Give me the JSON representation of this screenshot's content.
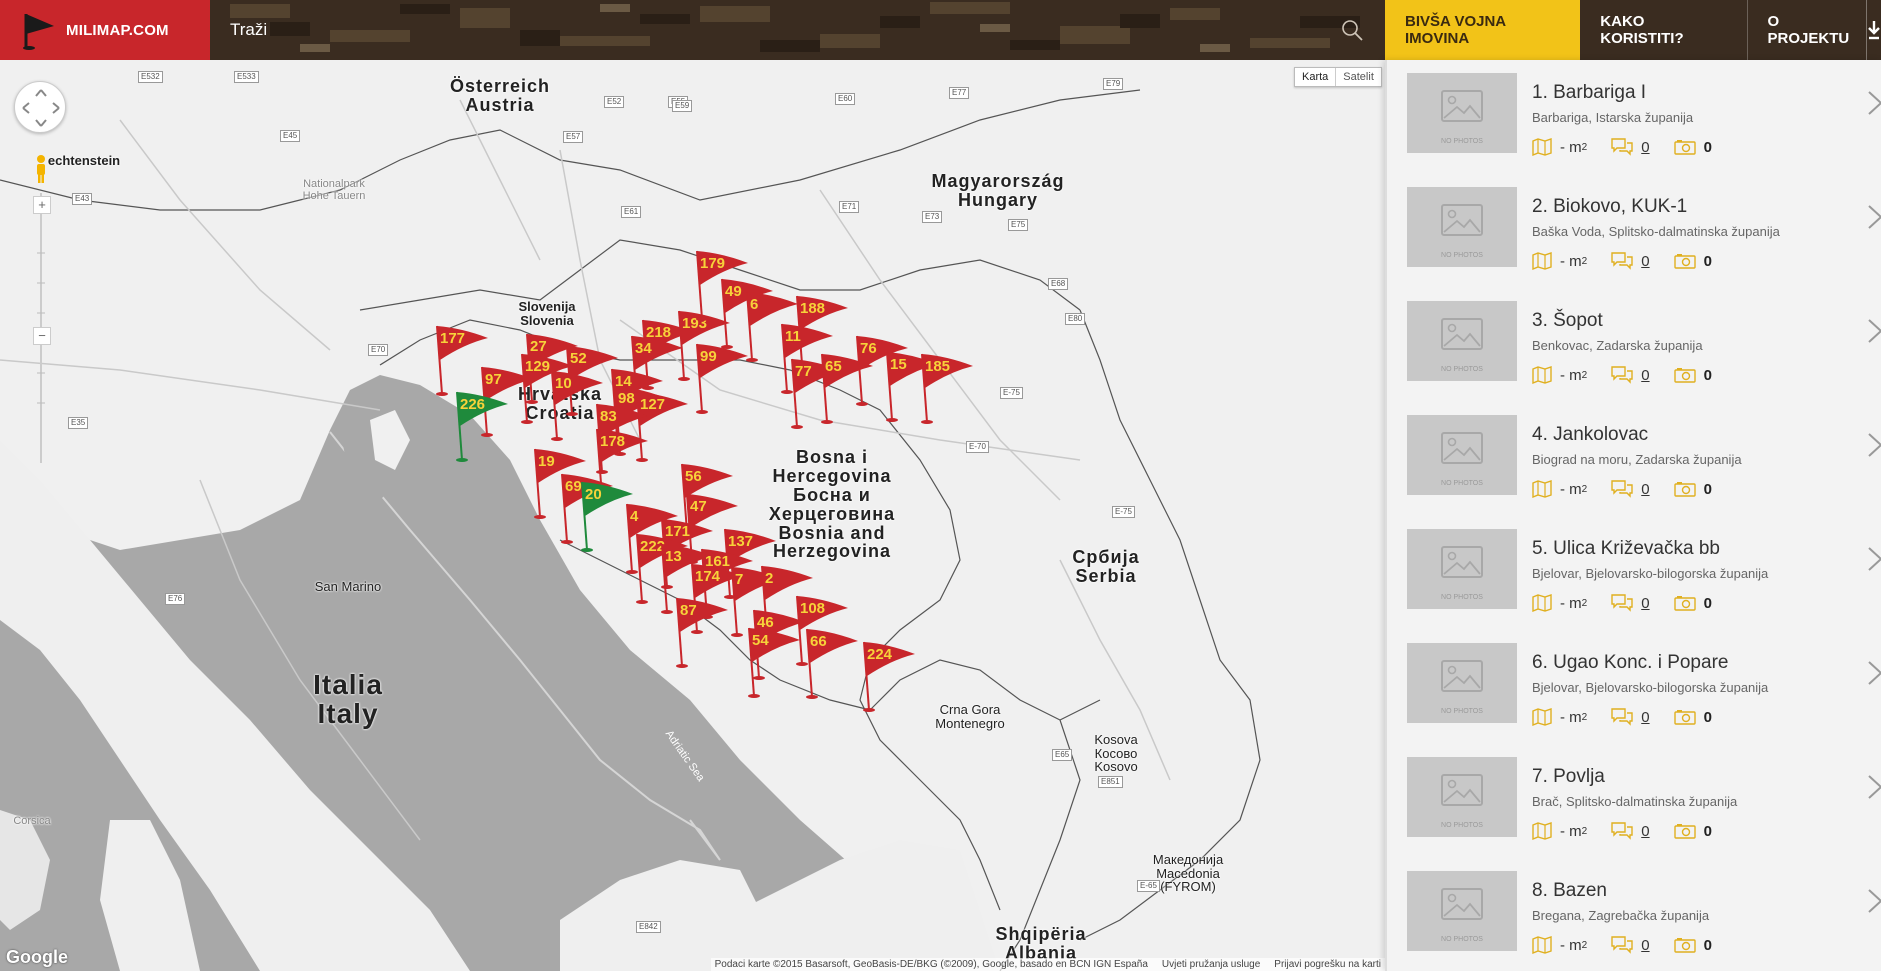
{
  "header": {
    "logo_text": "MILIMAP.COM",
    "search_placeholder": "Traži",
    "nav": [
      "BIVŠA VOJNA IMOVINA",
      "KAKO KORISTITI?",
      "O PROJEKTU"
    ],
    "brand_color": "#c8262b",
    "active_tab_color": "#f2c318"
  },
  "map": {
    "map_type": {
      "map": "Karta",
      "satellite": "Satelit"
    },
    "google_logo": "Google",
    "attribution": [
      "Podaci karte ©2015 Basarsoft, GeoBasis-DE/BKG (©2009), Google, basado en BCN IGN España",
      "Uvjeti pružanja usluge",
      "Prijavi pogrešku na karti"
    ],
    "labels": {
      "austria": "Österreich\nAustria",
      "hungary": "Magyarország\nHungary",
      "slovenia": "Slovenija\nSlovenia",
      "croatia": "Hrvatska\nCroatia",
      "bosnia": "Bosna i\nHercegovina\nБосна и\nХерцеговина\nBosnia and\nHerzegovina",
      "serbia": "Србија\nSerbia",
      "italy": "Italia\nItaly",
      "san_marino": "San Marino",
      "montenegro": "Crna Gora\nMontenegro",
      "kosovo": "Kosova\nКосово\nKosovo",
      "macedonia": "Македонија\nMacedonia\n(FYROM)",
      "albania": "Shqipëria\nAlbania",
      "liechtenstein": "echtenstein",
      "nationalpark": "Nationalpark\nHohe Tauern",
      "corsica": "Corsica",
      "adriatic": "Adriatic Sea"
    },
    "roads": [
      "E532",
      "E533",
      "E45",
      "E60",
      "E52",
      "E55",
      "E59",
      "E57",
      "E77",
      "E71",
      "E79",
      "E43",
      "E61",
      "E75",
      "E73",
      "E68",
      "E70",
      "E65",
      "E35",
      "E76",
      "E851",
      "E842",
      "E80",
      "E-75",
      "E-70",
      "E-65",
      "E-75"
    ],
    "markers": [
      {
        "n": "177",
        "c": "red"
      },
      {
        "n": "97",
        "c": "red"
      },
      {
        "n": "27",
        "c": "red"
      },
      {
        "n": "129",
        "c": "red"
      },
      {
        "n": "52",
        "c": "red"
      },
      {
        "n": "10",
        "c": "red"
      },
      {
        "n": "218",
        "c": "red"
      },
      {
        "n": "193",
        "c": "red"
      },
      {
        "n": "34",
        "c": "red"
      },
      {
        "n": "179",
        "c": "red"
      },
      {
        "n": "49",
        "c": "red"
      },
      {
        "n": "6",
        "c": "red"
      },
      {
        "n": "188",
        "c": "red"
      },
      {
        "n": "11",
        "c": "red"
      },
      {
        "n": "99",
        "c": "red"
      },
      {
        "n": "14",
        "c": "red"
      },
      {
        "n": "98",
        "c": "red"
      },
      {
        "n": "127",
        "c": "red"
      },
      {
        "n": "83",
        "c": "red"
      },
      {
        "n": "77",
        "c": "red"
      },
      {
        "n": "65",
        "c": "red"
      },
      {
        "n": "76",
        "c": "red"
      },
      {
        "n": "15",
        "c": "red"
      },
      {
        "n": "185",
        "c": "red"
      },
      {
        "n": "226",
        "c": "green"
      },
      {
        "n": "178",
        "c": "red"
      },
      {
        "n": "19",
        "c": "red"
      },
      {
        "n": "69",
        "c": "red"
      },
      {
        "n": "20",
        "c": "green"
      },
      {
        "n": "56",
        "c": "red"
      },
      {
        "n": "47",
        "c": "red"
      },
      {
        "n": "4",
        "c": "red"
      },
      {
        "n": "171",
        "c": "red"
      },
      {
        "n": "222",
        "c": "red"
      },
      {
        "n": "137",
        "c": "red"
      },
      {
        "n": "13",
        "c": "red"
      },
      {
        "n": "161",
        "c": "red"
      },
      {
        "n": "174",
        "c": "red"
      },
      {
        "n": "7",
        "c": "red"
      },
      {
        "n": "2",
        "c": "red"
      },
      {
        "n": "87",
        "c": "red"
      },
      {
        "n": "108",
        "c": "red"
      },
      {
        "n": "46",
        "c": "red"
      },
      {
        "n": "54",
        "c": "red"
      },
      {
        "n": "66",
        "c": "red"
      },
      {
        "n": "224",
        "c": "red"
      }
    ]
  },
  "list": [
    {
      "title": "1. Barbariga I",
      "location": "Barbariga, Istarska županija",
      "area": "- m",
      "comments": "0",
      "photos": "0",
      "no_photos": "NO PHOTOS"
    },
    {
      "title": "2. Biokovo, KUK-1",
      "location": "Baška Voda, Splitsko-dalmatinska županija",
      "area": "- m",
      "comments": "0",
      "photos": "0",
      "no_photos": "NO PHOTOS"
    },
    {
      "title": "3. Šopot",
      "location": "Benkovac, Zadarska županija",
      "area": "- m",
      "comments": "0",
      "photos": "0",
      "no_photos": "NO PHOTOS"
    },
    {
      "title": "4. Jankolovac",
      "location": "Biograd na moru, Zadarska županija",
      "area": "- m",
      "comments": "0",
      "photos": "0",
      "no_photos": "NO PHOTOS"
    },
    {
      "title": "5. Ulica Križevačka bb",
      "location": "Bjelovar, Bjelovarsko-bilogorska županija",
      "area": "- m",
      "comments": "0",
      "photos": "0",
      "no_photos": "NO PHOTOS"
    },
    {
      "title": "6. Ugao Konc. i Popare",
      "location": "Bjelovar, Bjelovarsko-bilogorska županija",
      "area": "- m",
      "comments": "0",
      "photos": "0",
      "no_photos": "NO PHOTOS"
    },
    {
      "title": "7. Povlja",
      "location": "Brač, Splitsko-dalmatinska županija",
      "area": "- m",
      "comments": "0",
      "photos": "0",
      "no_photos": "NO PHOTOS"
    },
    {
      "title": "8. Bazen",
      "location": "Bregana, Zagrebačka županija",
      "area": "- m",
      "comments": "0",
      "photos": "0",
      "no_photos": "NO PHOTOS"
    }
  ]
}
